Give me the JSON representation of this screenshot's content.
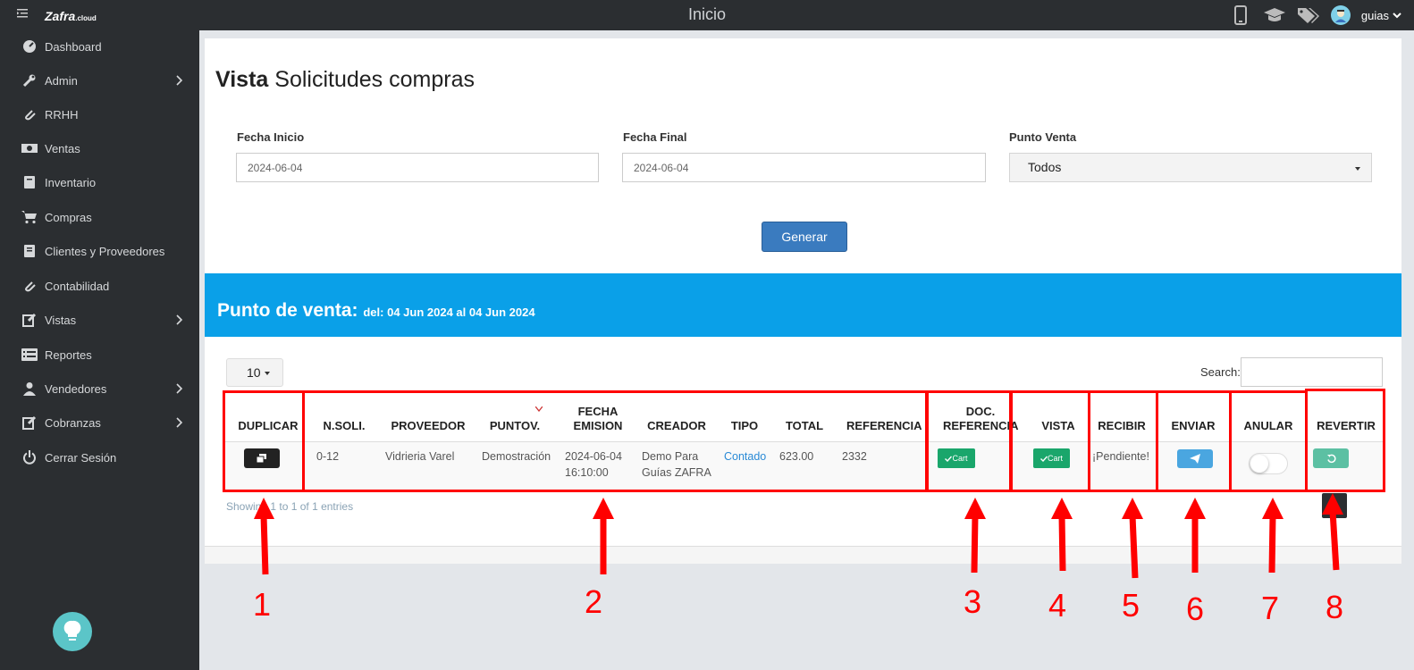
{
  "topbar": {
    "logo": "Zafra",
    "logo_suffix": ".cloud",
    "title": "Inicio",
    "user": "guias",
    "icons": [
      "mobile-icon",
      "graduation-cap-icon",
      "tags-icon",
      "user-avatar-icon"
    ]
  },
  "sidebar": {
    "items": [
      {
        "label": "Dashboard",
        "icon": "dashboard-icon",
        "chevron": false
      },
      {
        "label": "Admin",
        "icon": "wrench-icon",
        "chevron": true
      },
      {
        "label": "RRHH",
        "icon": "paperclip-icon",
        "chevron": false
      },
      {
        "label": "Ventas",
        "icon": "money-icon",
        "chevron": false
      },
      {
        "label": "Inventario",
        "icon": "book-icon",
        "chevron": false
      },
      {
        "label": "Compras",
        "icon": "cart-icon",
        "chevron": false
      },
      {
        "label": "Clientes y Proveedores",
        "icon": "address-book-icon",
        "chevron": false
      },
      {
        "label": "Contabilidad",
        "icon": "paperclip-icon",
        "chevron": false
      },
      {
        "label": "Vistas",
        "icon": "edit-icon",
        "chevron": true
      },
      {
        "label": "Reportes",
        "icon": "list-icon",
        "chevron": false
      },
      {
        "label": "Vendedores",
        "icon": "user-icon",
        "chevron": true
      },
      {
        "label": "Cobranzas",
        "icon": "edit-icon",
        "chevron": true
      },
      {
        "label": "Cerrar Sesión",
        "icon": "power-icon",
        "chevron": false
      }
    ]
  },
  "page": {
    "title_bold": "Vista",
    "title_rest": "Solicitudes compras"
  },
  "filters": {
    "fecha_inicio_label": "Fecha Inicio",
    "fecha_inicio_value": "2024-06-04",
    "fecha_final_label": "Fecha Final",
    "fecha_final_value": "2024-06-04",
    "punto_venta_label": "Punto Venta",
    "punto_venta_value": "Todos",
    "generar_label": "Generar"
  },
  "band": {
    "title": "Punto de venta:",
    "subtitle": "del: 04 Jun 2024 al 04 Jun 2024"
  },
  "table": {
    "length_value": "10",
    "search_label": "Search:",
    "headers": {
      "duplicar": "DUPLICAR",
      "nsoli": "N.SOLI.",
      "proveedor": "PROVEEDOR",
      "puntov": "PUNTOV.",
      "fecha_emision_1": "FECHA",
      "fecha_emision_2": "EMISION",
      "creador": "CREADOR",
      "tipo": "TIPO",
      "total": "TOTAL",
      "referencia": "REFERENCIA",
      "doc_ref_1": "DOC.",
      "doc_ref_2": "REFERENCIA",
      "vista": "VISTA",
      "recibir": "RECIBIR",
      "enviar": "ENVIAR",
      "anular": "ANULAR",
      "revertir": "REVERTIR"
    },
    "row": {
      "nsoli": "0-12",
      "proveedor": "Vidrieria Varel",
      "puntov": "Demostración",
      "fecha_1": "2024-06-04",
      "fecha_2": "16:10:00",
      "creador_1": "Demo Para",
      "creador_2": "Guías ZAFRA",
      "tipo": "Contado",
      "total": "623.00",
      "referencia": "2332",
      "doc_ref_btn": "Cart",
      "vista_btn": "Cart",
      "recibir": "¡Pendiente!"
    },
    "info": "Showing 1 to 1 of 1 entries"
  },
  "annotations": [
    "1",
    "2",
    "3",
    "4",
    "5",
    "6",
    "7",
    "8"
  ],
  "colors": {
    "sidebar_bg": "#2b2e31",
    "band_blue": "#0aa0e8",
    "btn_primary": "#3a7bbf",
    "btn_green": "#1aa66b",
    "annotation_red": "#ff0000",
    "link_blue": "#2a8ad6"
  }
}
